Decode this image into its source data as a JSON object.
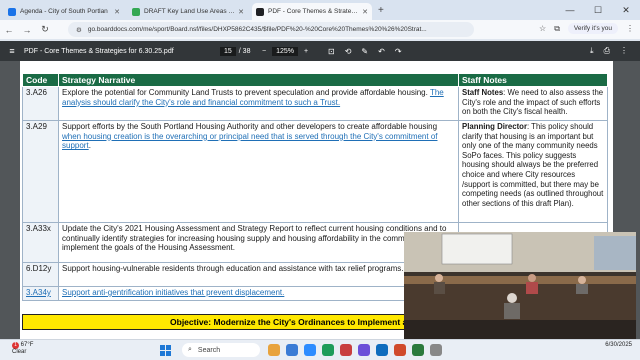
{
  "browser": {
    "tabs": [
      {
        "title": "Agenda - City of South Portlan",
        "favicon_color": "#1a73e8",
        "active": false
      },
      {
        "title": "DRAFT Key Land Use Areas - C",
        "favicon_color": "#34a853",
        "active": false
      },
      {
        "title": "PDF - Core Themes & Strategie",
        "favicon_color": "#202124",
        "active": true
      }
    ],
    "new_tab": "+",
    "url": "go.boarddocs.com/me/sport/Board.nsf/files/DHXP5862C435/$file/PDF%20-%20Core%20Themes%20%26%20Strat...",
    "profile_label": "Verify it's you"
  },
  "pdf": {
    "filename": "PDF - Core Themes & Strategies for 6.30.25.pdf",
    "current_page": "15",
    "total_pages": "/ 38",
    "zoom": "125%"
  },
  "table": {
    "headers": {
      "code": "Code",
      "narrative": "Strategy Narrative",
      "notes": "Staff Notes"
    },
    "rows": [
      {
        "code": "3.A26",
        "code_link": false,
        "text": "Explore the potential for Community Land Trusts to prevent speculation and provide affordable housing. ",
        "link": "The analysis should clarify the City's role and financial commitment to such a Trust.",
        "after": "",
        "note_label": "Staff Notes",
        "note": ": We need to also assess the City's role and the impact of such efforts on both the City's fiscal health."
      },
      {
        "code": "3.A29",
        "code_link": false,
        "text": "Support efforts by the South Portland Housing Authority and other developers to create affordable housing ",
        "link": "when housing creation is the overarching or principal need that is served through the City's commitment of support",
        "after": ".",
        "note_label": "Planning Director",
        "note": ": This policy should clarify that housing is an important but only one of the many community needs SoPo faces. This policy suggests housing should always be the preferred choice and where City resources /support is committed, but there may be competing needs (as outlined throughout other sections of this draft Plan)."
      },
      {
        "code": "3.A33x",
        "code_link": false,
        "text": "Update the City's 2021 Housing Assessment and Strategy Report to reflect current housing conditions and to continually identify strategies for increasing housing supply and housing affordability in the community. Actively implement the goals of the Housing Assessment.",
        "link": "",
        "after": "",
        "note_label": "",
        "note": ""
      },
      {
        "code": "6.D12y",
        "code_link": false,
        "text": "Support housing-vulnerable residents through education and assistance with tax relief programs.",
        "link": "",
        "after": "",
        "note_label": "",
        "note": ""
      },
      {
        "code": "3.A34y",
        "code_link": true,
        "text": "",
        "link": "Support anti-gentrification initiatives that prevent displacement.",
        "after": "",
        "note_label": "",
        "note": ""
      }
    ],
    "objective": "Objective: Modernize the City's Ordinances to Implement an Up-To-Date"
  },
  "taskbar": {
    "weather_temp": "67°F",
    "weather_desc": "Clear",
    "weather_badge": "1",
    "search_label": "Search",
    "time": "6/30/2025",
    "app_colors": [
      "#e8a33d",
      "#3a7bd5",
      "#2d8cff",
      "#1e9c5a",
      "#c83e3e",
      "#6b4fd8",
      "#0f6cbd",
      "#d04a2b",
      "#2b7a3d",
      "#888888"
    ]
  }
}
